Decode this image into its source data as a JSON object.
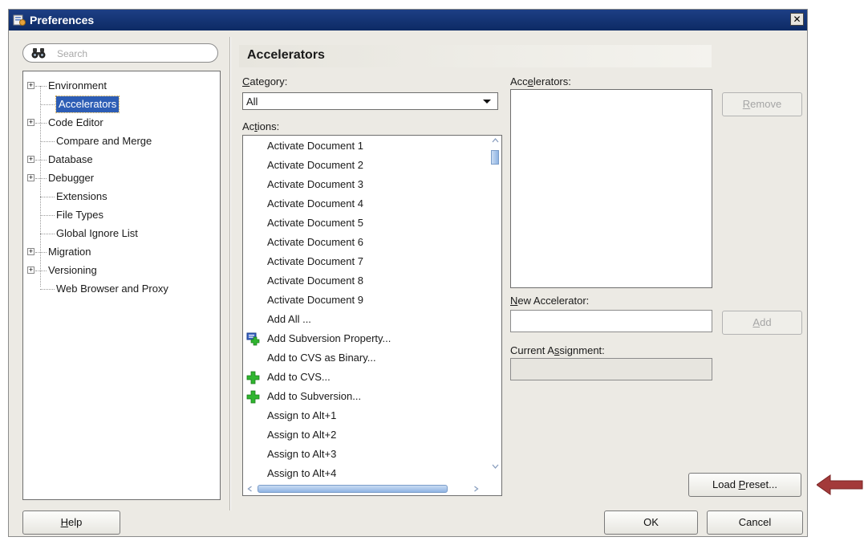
{
  "window": {
    "title": "Preferences",
    "close_glyph": "✕"
  },
  "search": {
    "placeholder": "Search"
  },
  "tree": {
    "items": [
      {
        "label": "Environment",
        "expandable": true
      },
      {
        "label": "Accelerators",
        "expandable": false,
        "selected": true
      },
      {
        "label": "Code Editor",
        "expandable": true
      },
      {
        "label": "Compare and Merge",
        "expandable": false
      },
      {
        "label": "Database",
        "expandable": true
      },
      {
        "label": "Debugger",
        "expandable": true
      },
      {
        "label": "Extensions",
        "expandable": false
      },
      {
        "label": "File Types",
        "expandable": false
      },
      {
        "label": "Global Ignore List",
        "expandable": false
      },
      {
        "label": "Migration",
        "expandable": true
      },
      {
        "label": "Versioning",
        "expandable": true
      },
      {
        "label": "Web Browser and Proxy",
        "expandable": false
      }
    ]
  },
  "page": {
    "title": "Accelerators"
  },
  "category": {
    "label_u": "C",
    "label_rest": "ategory:",
    "value": "All"
  },
  "actions": {
    "label_pre": "Ac",
    "label_u": "t",
    "label_rest": "ions:",
    "items": [
      {
        "label": "Activate Document 1",
        "icon": ""
      },
      {
        "label": "Activate Document 2",
        "icon": ""
      },
      {
        "label": "Activate Document 3",
        "icon": ""
      },
      {
        "label": "Activate Document 4",
        "icon": ""
      },
      {
        "label": "Activate Document 5",
        "icon": ""
      },
      {
        "label": "Activate Document 6",
        "icon": ""
      },
      {
        "label": "Activate Document 7",
        "icon": ""
      },
      {
        "label": "Activate Document 8",
        "icon": ""
      },
      {
        "label": "Activate Document 9",
        "icon": ""
      },
      {
        "label": "Add All ...",
        "icon": ""
      },
      {
        "label": "Add Subversion Property...",
        "icon": "add-property-icon"
      },
      {
        "label": "Add to CVS as Binary...",
        "icon": ""
      },
      {
        "label": "Add to CVS...",
        "icon": "green-plus-icon"
      },
      {
        "label": "Add to Subversion...",
        "icon": "green-plus-icon"
      },
      {
        "label": "Assign to Alt+1",
        "icon": ""
      },
      {
        "label": "Assign to Alt+2",
        "icon": ""
      },
      {
        "label": "Assign to Alt+3",
        "icon": ""
      },
      {
        "label": "Assign to Alt+4",
        "icon": ""
      }
    ]
  },
  "accelerators": {
    "label_pre": "Acc",
    "label_u": "e",
    "label_rest": "lerators:"
  },
  "new_accelerator": {
    "label_u": "N",
    "label_rest": "ew Accelerator:",
    "value": ""
  },
  "current_assignment": {
    "label_pre": "Current A",
    "label_u": "s",
    "label_rest": "signment:",
    "value": ""
  },
  "buttons": {
    "remove_u": "R",
    "remove_rest": "emove",
    "add_u": "A",
    "add_rest": "dd",
    "load_pre": "Load ",
    "load_u": "P",
    "load_rest": "reset...",
    "help_pre": "",
    "help_u": "H",
    "help_rest": "elp",
    "ok": "OK",
    "cancel": "Cancel"
  },
  "colors": {
    "title_bar": "#0d2a64",
    "selection": "#2d5db5",
    "callout_arrow": "#a33a3a",
    "plus_green": "#2fb52f"
  }
}
